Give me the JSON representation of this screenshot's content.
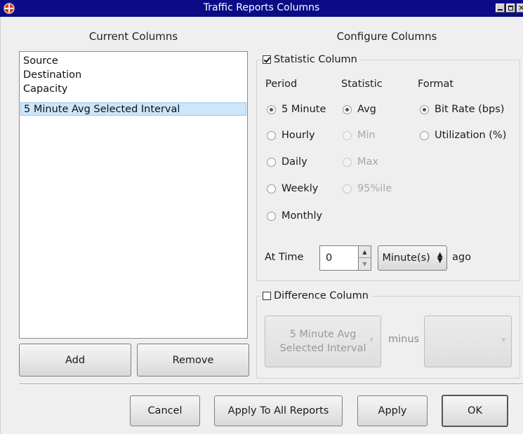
{
  "window": {
    "title": "Traffic Reports Columns",
    "title_bar_color": "#0b0b86"
  },
  "left": {
    "header": "Current Columns",
    "columns": [
      {
        "label": "Source",
        "selected": false
      },
      {
        "label": "Destination",
        "selected": false
      },
      {
        "label": "Capacity",
        "selected": false
      },
      {
        "label": "5 Minute Avg Selected Interval",
        "selected": true
      }
    ],
    "add_label": "Add",
    "remove_label": "Remove"
  },
  "right": {
    "header": "Configure Columns",
    "statistic_group": {
      "label": "Statistic Column",
      "checked": true,
      "period": {
        "header": "Period",
        "options": [
          {
            "label": "5 Minute",
            "selected": true
          },
          {
            "label": "Hourly",
            "selected": false
          },
          {
            "label": "Daily",
            "selected": false
          },
          {
            "label": "Weekly",
            "selected": false
          },
          {
            "label": "Monthly",
            "selected": false
          }
        ]
      },
      "statistic": {
        "header": "Statistic",
        "options": [
          {
            "label": "Avg",
            "selected": true,
            "enabled": true
          },
          {
            "label": "Min",
            "selected": false,
            "enabled": false
          },
          {
            "label": "Max",
            "selected": false,
            "enabled": false
          },
          {
            "label": "95%ile",
            "selected": false,
            "enabled": false
          }
        ]
      },
      "format": {
        "header": "Format",
        "options": [
          {
            "label": "Bit Rate (bps)",
            "selected": true
          },
          {
            "label": "Utilization (%)",
            "selected": false
          }
        ]
      },
      "at_time": {
        "label": "At Time",
        "value": "0",
        "unit": "Minute(s)",
        "suffix": "ago"
      }
    },
    "difference_group": {
      "label": "Difference Column",
      "checked": false,
      "left_select_line1": "5 Minute Avg",
      "left_select_line2": "Selected Interval",
      "minus_label": "minus",
      "right_select": ""
    }
  },
  "footer": {
    "cancel_label": "Cancel",
    "apply_all_label": "Apply To All Reports",
    "apply_label": "Apply",
    "ok_label": "OK"
  }
}
